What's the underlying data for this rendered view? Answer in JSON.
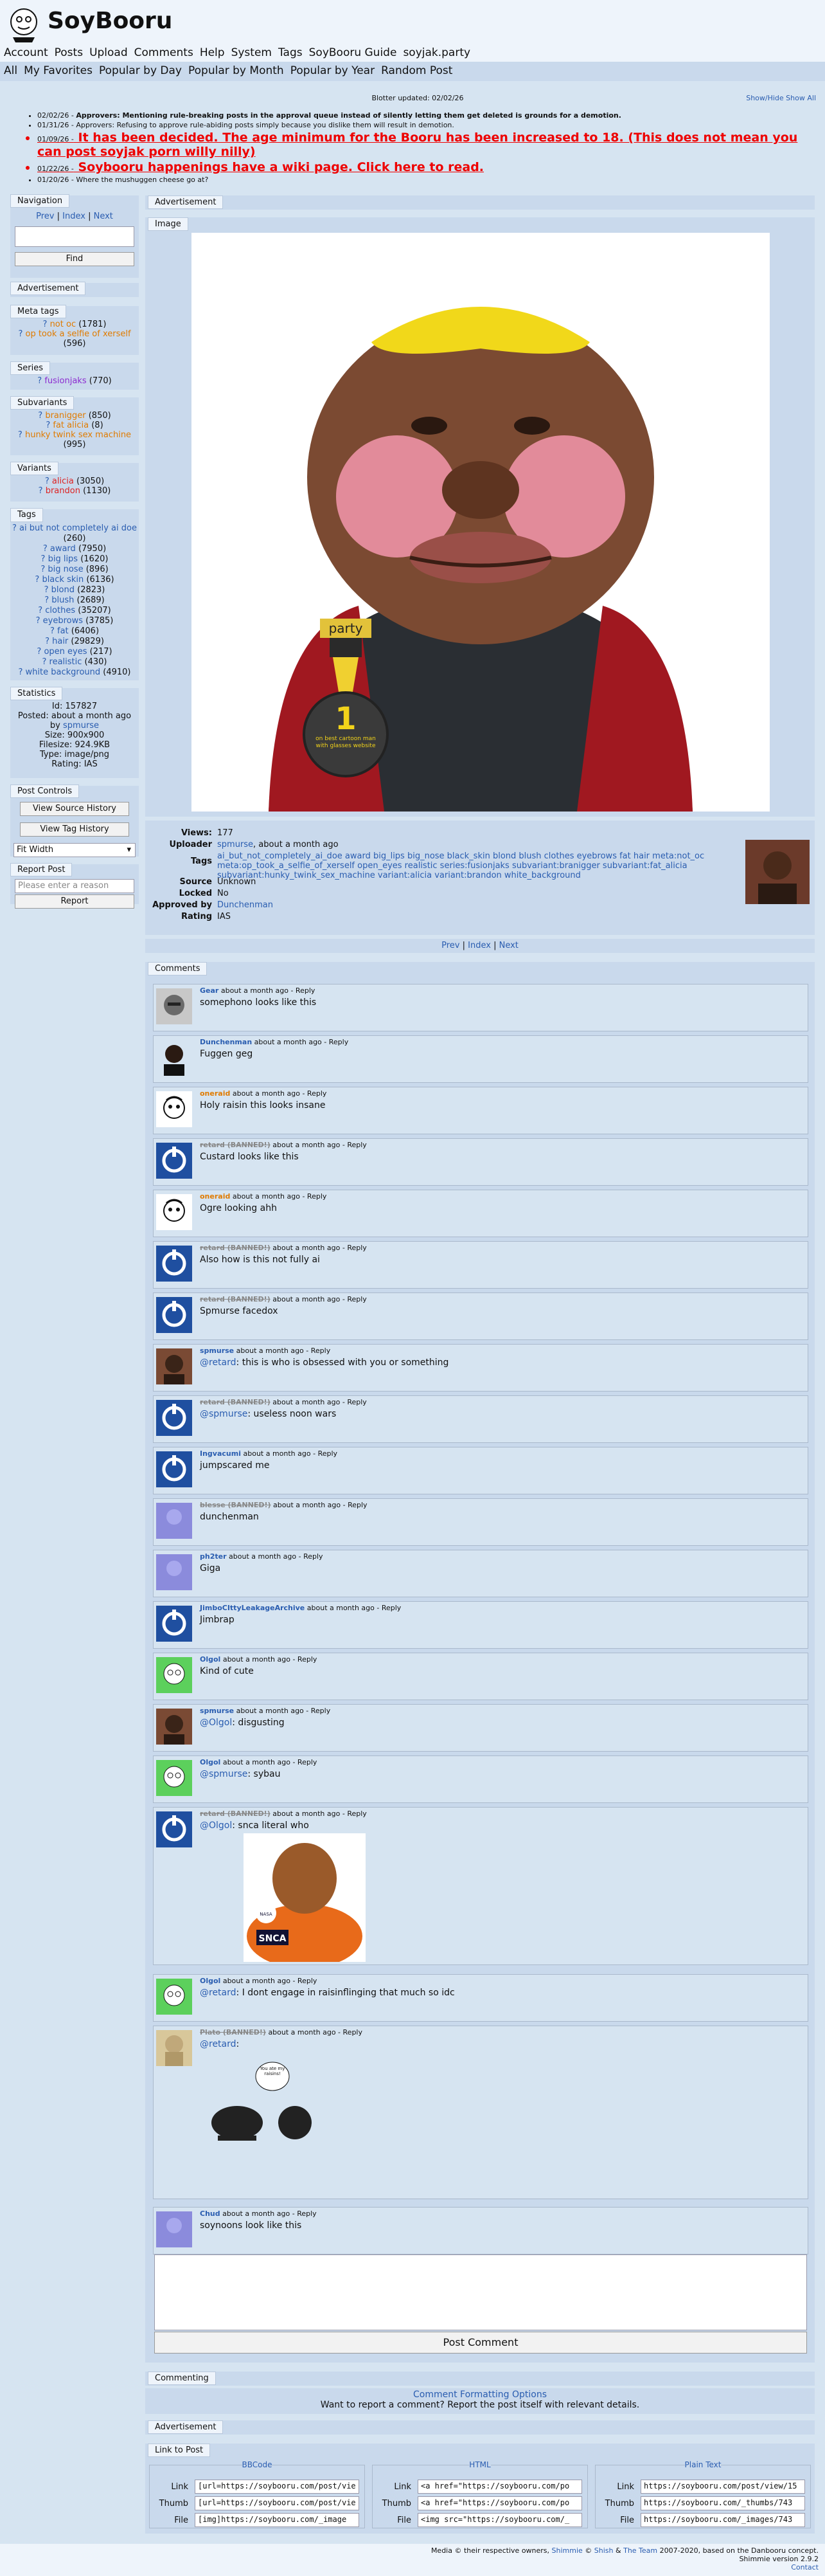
{
  "site": {
    "title": "SoyBooru"
  },
  "nav1": [
    "Account",
    "Posts",
    "Upload",
    "Comments",
    "Help",
    "System",
    "Tags",
    "SoyBooru Guide",
    "soyjak.party"
  ],
  "nav2": [
    "All",
    "My Favorites",
    "Popular by Day",
    "Popular by Month",
    "Popular by Year",
    "Random Post"
  ],
  "blotter": {
    "title": "Blotter updated: 02/02/26",
    "toggle": "Show/Hide Show All",
    "entries": [
      {
        "date": "02/02/26 -",
        "text": "Approvers: Mentioning rule-breaking posts in the approval queue instead of silently letting them get deleted is grounds for a demotion.",
        "style": "bold"
      },
      {
        "date": "01/31/26 -",
        "text": "Approvers: Refusing to approve rule-abiding posts simply because you dislike them will result in demotion.",
        "style": "normal"
      },
      {
        "date": "01/09/26 -",
        "text": "It has been decided. The age minimum for the Booru has been increased to 18. (This does not mean you can post soyjak porn willy nilly)",
        "style": "big"
      },
      {
        "date": "01/22/26 -",
        "text": "Soybooru happenings have a wiki page. Click here to read.",
        "style": "med"
      },
      {
        "date": "01/20/26 -",
        "text": "Where the mushuggen cheese go at?",
        "style": "normal"
      }
    ]
  },
  "sidebar": {
    "navigation": {
      "title": "Navigation",
      "prev": "Prev",
      "index": "Index",
      "next": "Next",
      "find": "Find"
    },
    "advertisement": "Advertisement",
    "meta_tags": {
      "title": "Meta tags",
      "items": [
        {
          "name": "not oc",
          "count": "(1781)",
          "color": "orange"
        },
        {
          "name": "op took a selfie of xerself",
          "count": "(596)",
          "color": "orange"
        }
      ]
    },
    "series": {
      "title": "Series",
      "items": [
        {
          "name": "fusionjaks",
          "count": "(770)",
          "color": "purple"
        }
      ]
    },
    "subvariants": {
      "title": "Subvariants",
      "items": [
        {
          "name": "branigger",
          "count": "(850)",
          "color": "orange"
        },
        {
          "name": "fat alicia",
          "count": "(8)",
          "color": "orange"
        },
        {
          "name": "hunky twink sex machine",
          "count": "(995)",
          "color": "orange"
        }
      ]
    },
    "variants": {
      "title": "Variants",
      "items": [
        {
          "name": "alicia",
          "count": "(3050)",
          "color": "red"
        },
        {
          "name": "brandon",
          "count": "(1130)",
          "color": "red"
        }
      ]
    },
    "tags": {
      "title": "Tags",
      "items": [
        {
          "name": "ai but not completely ai doe",
          "count": "(260)"
        },
        {
          "name": "award",
          "count": "(7950)"
        },
        {
          "name": "big lips",
          "count": "(1620)"
        },
        {
          "name": "big nose",
          "count": "(896)"
        },
        {
          "name": "black skin",
          "count": "(6136)"
        },
        {
          "name": "blond",
          "count": "(2823)"
        },
        {
          "name": "blush",
          "count": "(2689)"
        },
        {
          "name": "clothes",
          "count": "(35207)"
        },
        {
          "name": "eyebrows",
          "count": "(3785)"
        },
        {
          "name": "fat",
          "count": "(6406)"
        },
        {
          "name": "hair",
          "count": "(29829)"
        },
        {
          "name": "open eyes",
          "count": "(217)"
        },
        {
          "name": "realistic",
          "count": "(430)"
        },
        {
          "name": "white background",
          "count": "(4910)"
        }
      ]
    },
    "statistics": {
      "title": "Statistics",
      "id": "Id: 157827",
      "posted": "Posted: about a month ago",
      "by": "by",
      "uploader": "spmurse",
      "size": "Size: 900x900",
      "filesize": "Filesize: 924.9KB",
      "type": "Type: image/png",
      "rating": "Rating: IAS"
    },
    "post_controls": {
      "title": "Post Controls",
      "source_history": "View Source History",
      "tag_history": "View Tag History",
      "fit": "Fit Width"
    },
    "report": {
      "title": "Report Post",
      "placeholder": "Please enter a reason",
      "button": "Report"
    }
  },
  "main": {
    "advertisement": "Advertisement",
    "image_label": "Image",
    "badge_text": "party",
    "badge_medal_text": "1",
    "badge_ribbon_text": "on best cartoon man with glasses website",
    "info": {
      "views_label": "Views:",
      "views": "177",
      "uploader_label": "Uploader",
      "uploader": "spmurse",
      "uploader_time": ", about a month ago",
      "tags_label": "Tags",
      "tags": "ai_but_not_completely_ai_doe award big_lips big_nose black_skin blond blush clothes eyebrows fat hair meta:not_oc meta:op_took_a_selfie_of_xerself open_eyes realistic series:fusionjaks subvariant:branigger subvariant:fat_alicia subvariant:hunky_twink_sex_machine variant:alicia variant:brandon white_background",
      "source_label": "Source",
      "source": "Unknown",
      "locked_label": "Locked",
      "locked": "No",
      "approved_label": "Approved by",
      "approved": "Dunchenman",
      "rating_label": "Rating",
      "rating": "IAS"
    },
    "pager": {
      "prev": "Prev",
      "index": "Index",
      "next": "Next"
    }
  },
  "comments_title": "Comments",
  "comments": [
    {
      "user": "Gear",
      "ustyle": "u",
      "meta": "about a month ago - Reply",
      "text": "somephono looks like this",
      "avatar": "gear"
    },
    {
      "user": "Dunchenman",
      "ustyle": "u",
      "meta": "about a month ago - Reply",
      "text": "Fuggen geg",
      "avatar": "dark"
    },
    {
      "user": "oneraid",
      "ustyle": "o",
      "meta": "about a month ago - Reply",
      "text": "Holy raisin this looks insane",
      "avatar": "sketch"
    },
    {
      "user": "retard (BANNED!)",
      "ustyle": "b",
      "meta": "about a month ago - Reply",
      "text": "Custard looks like this",
      "avatar": "blue"
    },
    {
      "user": "oneraid",
      "ustyle": "o",
      "meta": "about a month ago - Reply",
      "text": "Ogre looking ahh",
      "avatar": "sketch"
    },
    {
      "user": "retard (BANNED!)",
      "ustyle": "b",
      "meta": "about a month ago - Reply",
      "text": "Also how is this not fully ai",
      "avatar": "blue"
    },
    {
      "user": "retard (BANNED!)",
      "ustyle": "b",
      "meta": "about a month ago - Reply",
      "text": "Spmurse facedox",
      "avatar": "blue"
    },
    {
      "user": "spmurse",
      "ustyle": "u",
      "meta": "about a month ago - Reply",
      "mention": "@retard",
      "text": ": this is who is obsessed with you or something",
      "avatar": "photo"
    },
    {
      "user": "retard (BANNED!)",
      "ustyle": "b",
      "meta": "about a month ago - Reply",
      "mention": "@spmurse",
      "text": ": useless noon wars",
      "avatar": "blue"
    },
    {
      "user": "Ingvacumi",
      "ustyle": "u",
      "meta": "about a month ago - Reply",
      "text": "jumpscared me",
      "avatar": "blue"
    },
    {
      "user": "blesse (BANNED!)",
      "ustyle": "b",
      "meta": "about a month ago - Reply",
      "text": "dunchenman",
      "avatar": "purple"
    },
    {
      "user": "ph2ter",
      "ustyle": "u",
      "meta": "about a month ago - Reply",
      "text": "Giga",
      "avatar": "purple"
    },
    {
      "user": "JimboCIttyLeakageArchive",
      "ustyle": "u",
      "meta": "about a month ago - Reply",
      "text": "Jimbrap",
      "avatar": "blue"
    },
    {
      "user": "Olgol",
      "ustyle": "u",
      "meta": "about a month ago - Reply",
      "text": "Kind of cute",
      "avatar": "green"
    },
    {
      "user": "spmurse",
      "ustyle": "u",
      "meta": "about a month ago - Reply",
      "mention": "@Olgol",
      "text": ": disgusting",
      "avatar": "photo"
    },
    {
      "user": "Olgol",
      "ustyle": "u",
      "meta": "about a month ago - Reply",
      "mention": "@spmurse",
      "text": ": sybau",
      "avatar": "green"
    }
  ],
  "big_comments": [
    {
      "user": "retard (BANNED!)",
      "ustyle": "b",
      "meta": "about a month ago - Reply",
      "mention": "@Olgol",
      "text": ": snca literal who",
      "avatar": "blue",
      "img_text": "SNCA",
      "img_patch": "NASA"
    },
    {
      "user": "Olgol",
      "ustyle": "u",
      "meta": "about a month ago - Reply",
      "mention": "@retard",
      "text": ": I dont engage in raisinflinging that much so idc",
      "avatar": "green"
    },
    {
      "user": "Plato (BANNED!)",
      "ustyle": "b",
      "meta": "about a month ago - Reply",
      "mention": "@retard",
      "text": ":",
      "avatar": "bust",
      "img_text": "You ate my raisins!"
    },
    {
      "user": "Chud",
      "ustyle": "u",
      "meta": "about a month ago - Reply",
      "text": "soynoons look like this",
      "avatar": "purple"
    }
  ],
  "post_comment": "Post Comment",
  "commenting": {
    "title": "Commenting",
    "options": "Comment Formatting Options",
    "report": "Want to report a comment? Report the post itself with relevant details."
  },
  "advertisement_bottom": "Advertisement",
  "link_to_post": {
    "title": "Link to Post",
    "groups": [
      {
        "legend": "BBCode",
        "rows": [
          {
            "label": "Link",
            "value": "[url=https://soybooru.com/post/vie"
          },
          {
            "label": "Thumb",
            "value": "[url=https://soybooru.com/post/vie"
          },
          {
            "label": "File",
            "value": "[img]https://soybooru.com/_image"
          }
        ]
      },
      {
        "legend": "HTML",
        "rows": [
          {
            "label": "Link",
            "value": "<a href=\"https://soybooru.com/po"
          },
          {
            "label": "Thumb",
            "value": "<a href=\"https://soybooru.com/po"
          },
          {
            "label": "File",
            "value": "<img src=\"https://soybooru.com/_"
          }
        ]
      },
      {
        "legend": "Plain Text",
        "rows": [
          {
            "label": "Link",
            "value": "https://soybooru.com/post/view/15"
          },
          {
            "label": "Thumb",
            "value": "https://soybooru.com/_thumbs/743"
          },
          {
            "label": "File",
            "value": "https://soybooru.com/_images/743"
          }
        ]
      }
    ]
  },
  "footer": {
    "line1_a": "Media © their respective owners, ",
    "shimmie": "Shimmie",
    "line1_b": " © ",
    "shish": "Shish",
    "line1_c": " & ",
    "team": "The Team",
    "line1_d": " 2007-2020, based on the Danbooru concept.",
    "line2": "Shimmie version 2.9.2",
    "contact": "Contact"
  },
  "colors": {
    "bg": "#d6e4f1",
    "panel": "#c9d9ec",
    "link": "#2a5db0",
    "alert": "#ee0000"
  }
}
